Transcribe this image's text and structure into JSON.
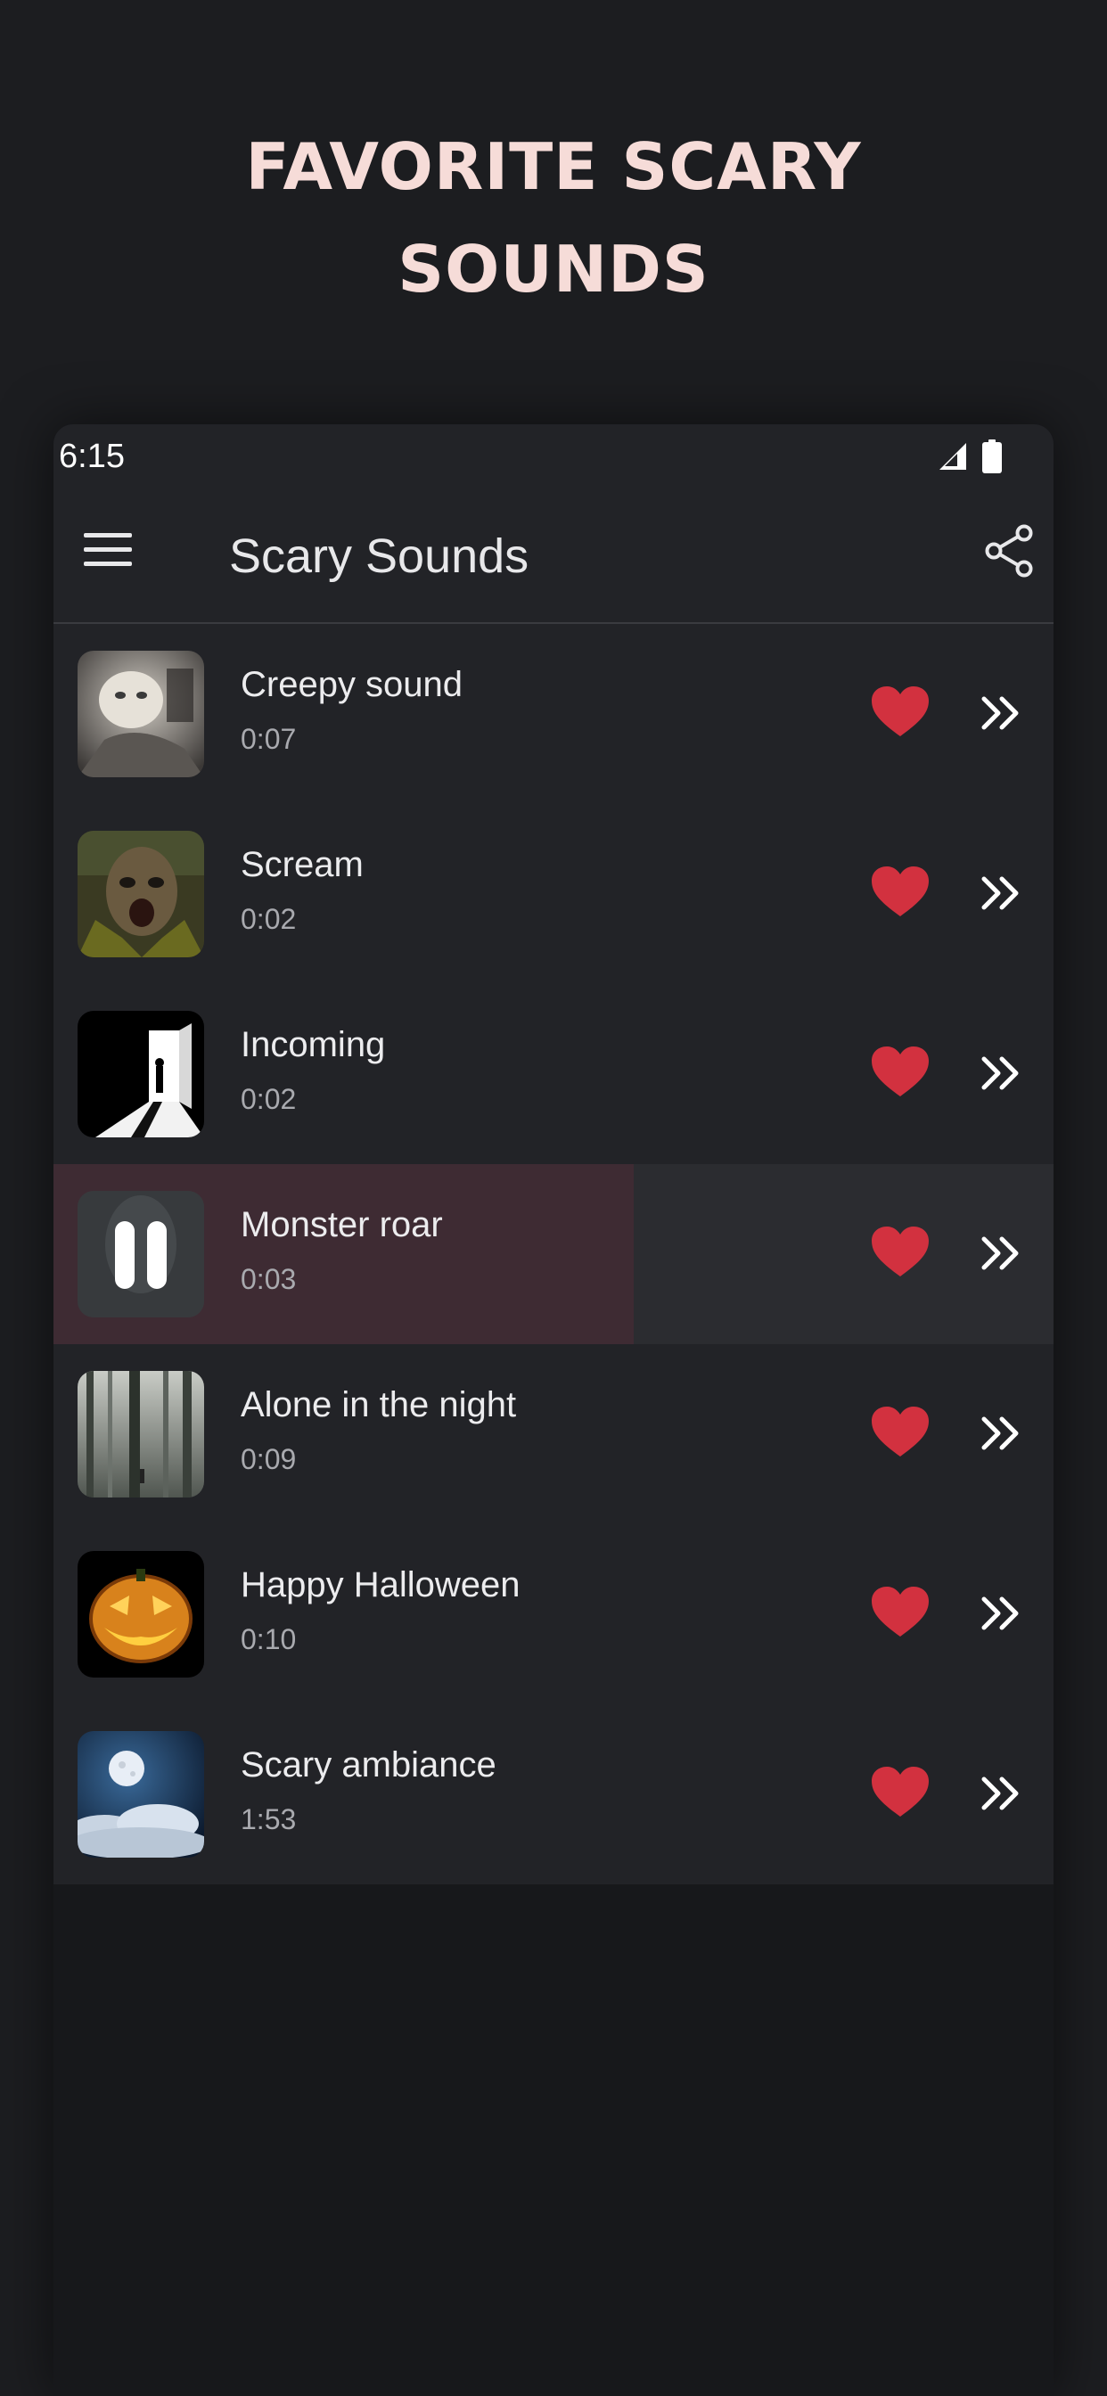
{
  "promo": {
    "title_line1": "FAVORITE SCARY",
    "title_line2": "SOUNDS"
  },
  "status_bar": {
    "time": "6:15",
    "icons": [
      "signal-icon",
      "battery-icon"
    ]
  },
  "app_bar": {
    "title": "Scary Sounds",
    "menu_icon": "hamburger-menu-icon",
    "share_icon": "share-icon"
  },
  "colors": {
    "background": "#1c1d20",
    "row_background": "#222327",
    "playing_progress": "#3e2b33",
    "heart": "#d2313f",
    "promo_text": "#f6dcd8"
  },
  "sounds": [
    {
      "title": "Creepy sound",
      "duration": "0:07",
      "favorite": true,
      "thumbnail": "doll-image"
    },
    {
      "title": "Scream",
      "duration": "0:02",
      "favorite": true,
      "thumbnail": "zombie-face-image"
    },
    {
      "title": "Incoming",
      "duration": "0:02",
      "favorite": true,
      "thumbnail": "open-door-silhouette-image"
    },
    {
      "title": "Monster roar",
      "duration": "0:03",
      "favorite": true,
      "thumbnail": "ghost-girl-image",
      "playing": true,
      "progress": 0.58
    },
    {
      "title": "Alone in the night",
      "duration": "0:09",
      "favorite": true,
      "thumbnail": "foggy-forest-image"
    },
    {
      "title": "Happy Halloween",
      "duration": "0:10",
      "favorite": true,
      "thumbnail": "jack-o-lantern-image"
    },
    {
      "title": "Scary ambiance",
      "duration": "1:53",
      "favorite": true,
      "thumbnail": "moon-clouds-image"
    }
  ]
}
